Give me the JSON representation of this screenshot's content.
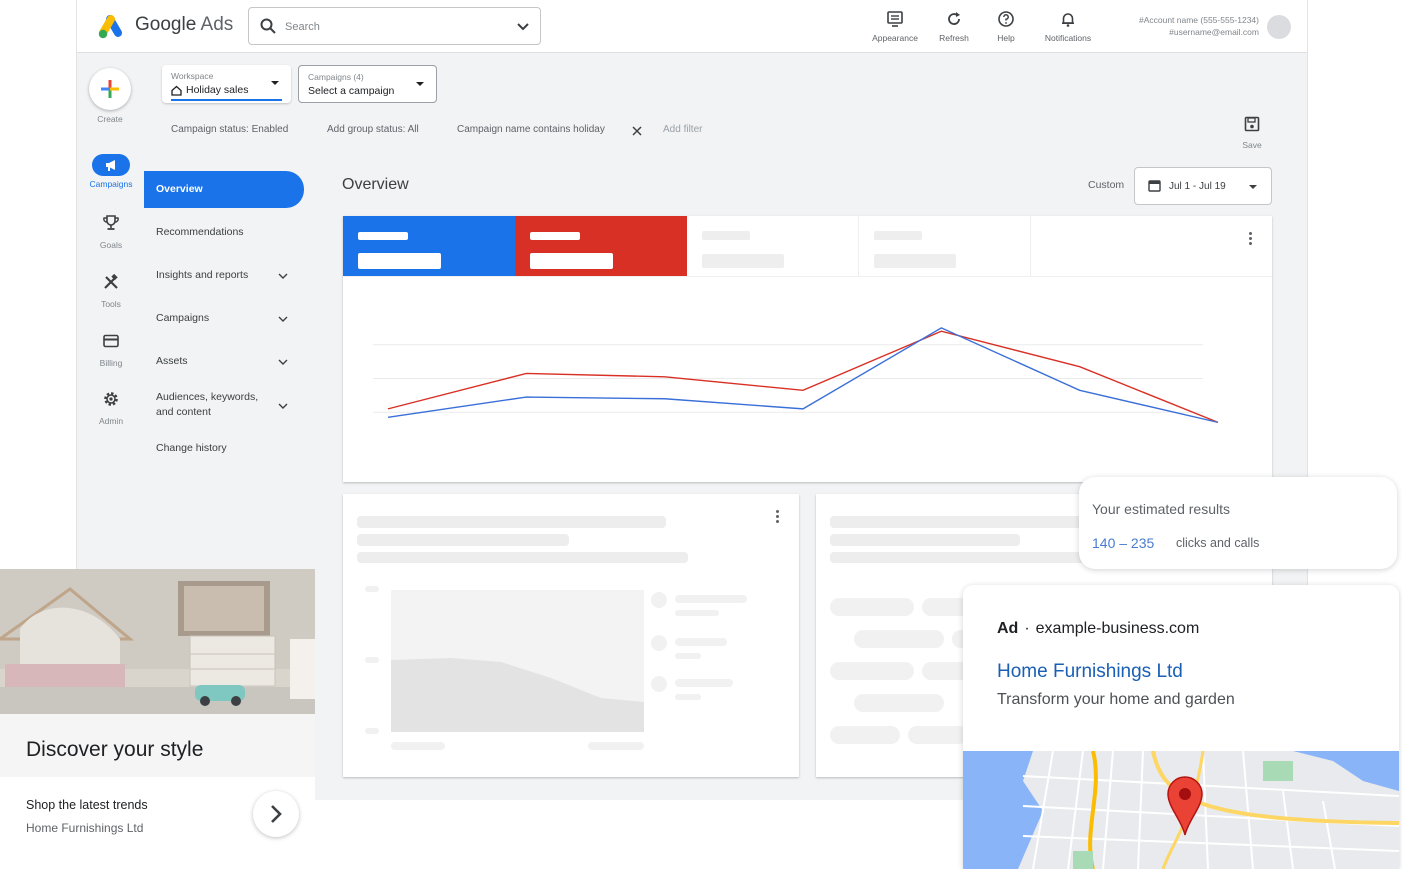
{
  "app": {
    "brand": "Google",
    "brand_suffix": "Ads"
  },
  "search": {
    "placeholder": "Search"
  },
  "toolbar": {
    "appearance": "Appearance",
    "refresh": "Refresh",
    "help": "Help",
    "notifications": "Notifications"
  },
  "account": {
    "name": "#Account name (555-555-1234)",
    "email": "#username@email.com"
  },
  "rail": {
    "create": "Create",
    "campaigns": "Campaigns",
    "goals": "Goals",
    "tools": "Tools",
    "billing": "Billing",
    "admin": "Admin"
  },
  "workspace": {
    "label": "Workspace",
    "value": "Holiday sales"
  },
  "campaign_select": {
    "label": "Campaigns (4)",
    "value": "Select a campaign"
  },
  "filters": {
    "status": "Campaign status: Enabled",
    "ad_group": "Add group status: All",
    "name": "Campaign name contains holiday",
    "add": "Add filter"
  },
  "save_label": "Save",
  "sidenav": {
    "overview": "Overview",
    "recommendations": "Recommendations",
    "insights": "Insights and reports",
    "campaigns": "Campaigns",
    "assets": "Assets",
    "audiences_1": "Audiences, keywords,",
    "audiences_2": "and content",
    "change_history": "Change history"
  },
  "overview": {
    "title": "Overview",
    "custom_label": "Custom",
    "date_range": "Jul 1 - Jul 19"
  },
  "colors": {
    "primary": "#1a73e8",
    "red": "#d93025",
    "accent_blue": "#4a7bd0"
  },
  "chart_data": {
    "type": "line",
    "x": [
      1,
      2,
      3,
      4,
      5,
      6,
      7
    ],
    "series": [
      {
        "values": [
          2.2,
          4.3,
          4.1,
          3.3,
          6.8,
          4.7,
          1.4
        ]
      },
      {
        "values": [
          1.7,
          2.9,
          2.8,
          2.2,
          7.0,
          3.3,
          1.4
        ]
      }
    ],
    "series_colors": [
      "#d93025",
      "#3b6fd8"
    ],
    "ylim": [
      0,
      8
    ],
    "grid": true
  },
  "estimate": {
    "heading": "Your estimated results",
    "range": "140 – 235",
    "unit": "clicks and calls"
  },
  "ad": {
    "badge": "Ad",
    "separator": "·",
    "domain": "example-business.com",
    "business": "Home Furnishings Ltd",
    "description": "Transform your home and garden"
  },
  "promo": {
    "title": "Discover your style",
    "subtitle": "Shop the latest trends",
    "source": "Home Furnishings Ltd"
  }
}
